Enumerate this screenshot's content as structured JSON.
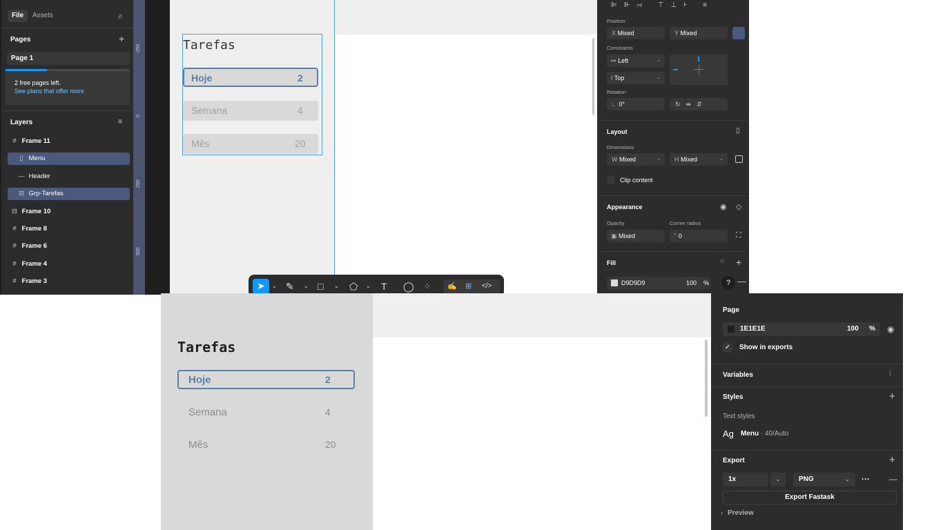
{
  "top": {
    "left_panel": {
      "tabs": {
        "file": "File",
        "assets": "Assets"
      },
      "pages_title": "Pages",
      "pages": [
        "Page 1"
      ],
      "plan_notice": "2 free pages left.",
      "plan_link": "See plans that offer more",
      "layers_title": "Layers",
      "layers": [
        {
          "label": "Frame 11",
          "icon": "#",
          "selected": false,
          "indent": 0
        },
        {
          "label": "Menu",
          "icon": "▯",
          "selected": true,
          "indent": 1
        },
        {
          "label": "Header",
          "icon": "—",
          "selected": false,
          "indent": 1
        },
        {
          "label": "Grp-Tarefas",
          "icon": "⊟",
          "selected": true,
          "indent": 1
        },
        {
          "label": "Frame 10",
          "icon": "⊟",
          "selected": false,
          "indent": 0
        },
        {
          "label": "Frame 8",
          "icon": "#",
          "selected": false,
          "indent": 0
        },
        {
          "label": "Frame 6",
          "icon": "#",
          "selected": false,
          "indent": 0
        },
        {
          "label": "Frame 4",
          "icon": "#",
          "selected": false,
          "indent": 0
        },
        {
          "label": "Frame 3",
          "icon": "#",
          "selected": false,
          "indent": 0
        }
      ]
    },
    "ruler_marks": [
      "-250",
      "0",
      "250",
      "500"
    ],
    "canvas": {
      "title": "Tarefas",
      "items": [
        {
          "name": "Hoje",
          "count": "2",
          "active": true
        },
        {
          "name": "Semana",
          "count": "4",
          "active": false
        },
        {
          "name": "Mês",
          "count": "20",
          "active": false
        }
      ]
    },
    "right_panel": {
      "position_label": "Position",
      "x_prefix": "X",
      "x_value": "Mixed",
      "y_prefix": "Y",
      "y_value": "Mixed",
      "constraints_label": "Constraints",
      "constraint_h": "Left",
      "constraint_v": "Top",
      "rotation_label": "Rotation",
      "rotation_value": "0°",
      "layout_title": "Layout",
      "dimensions_label": "Dimensions",
      "w_prefix": "W",
      "w_value": "Mixed",
      "h_prefix": "H",
      "h_value": "Mixed",
      "clip_content": "Clip content",
      "appearance_title": "Appearance",
      "opacity_label": "Opacity",
      "opacity_value": "Mixed",
      "corner_label": "Corner radius",
      "corner_value": "0",
      "fill_title": "Fill",
      "fill_hex": "D9D9D9",
      "fill_color": "#d9d9d9",
      "fill_opacity": "100",
      "fill_unit": "%",
      "help": "?"
    },
    "toolbar": [
      "move-tool",
      "pen-tool",
      "frame-tool",
      "shape-tool",
      "text-tool",
      "comment-tool",
      "actions-tool",
      "draw-tool",
      "design-tool",
      "dev-mode-tool"
    ]
  },
  "bottom": {
    "canvas": {
      "title": "Tarefas",
      "items": [
        {
          "name": "Hoje",
          "count": "2",
          "active": true
        },
        {
          "name": "Semana",
          "count": "4",
          "active": false
        },
        {
          "name": "Mês",
          "count": "20",
          "active": false
        }
      ]
    },
    "right_panel": {
      "page_title": "Page",
      "page_hex": "1E1E1E",
      "page_color": "#1e1e1e",
      "page_opacity": "100",
      "page_unit": "%",
      "show_exports": "Show in exports",
      "variables_title": "Variables",
      "styles_title": "Styles",
      "text_styles_label": "Text styles",
      "style_sample": "Ag",
      "style_name": "Menu",
      "style_spec": " · 40/Auto",
      "export_title": "Export",
      "export_scale": "1x",
      "export_format": "PNG",
      "export_button": "Export Fastask",
      "preview_label": "Preview"
    }
  },
  "colors": {
    "accent": "#0d99ff",
    "selection": "#4a5a7c",
    "active_item_text": "#5a7fa6",
    "frame_outline": "#4a9fd8"
  }
}
